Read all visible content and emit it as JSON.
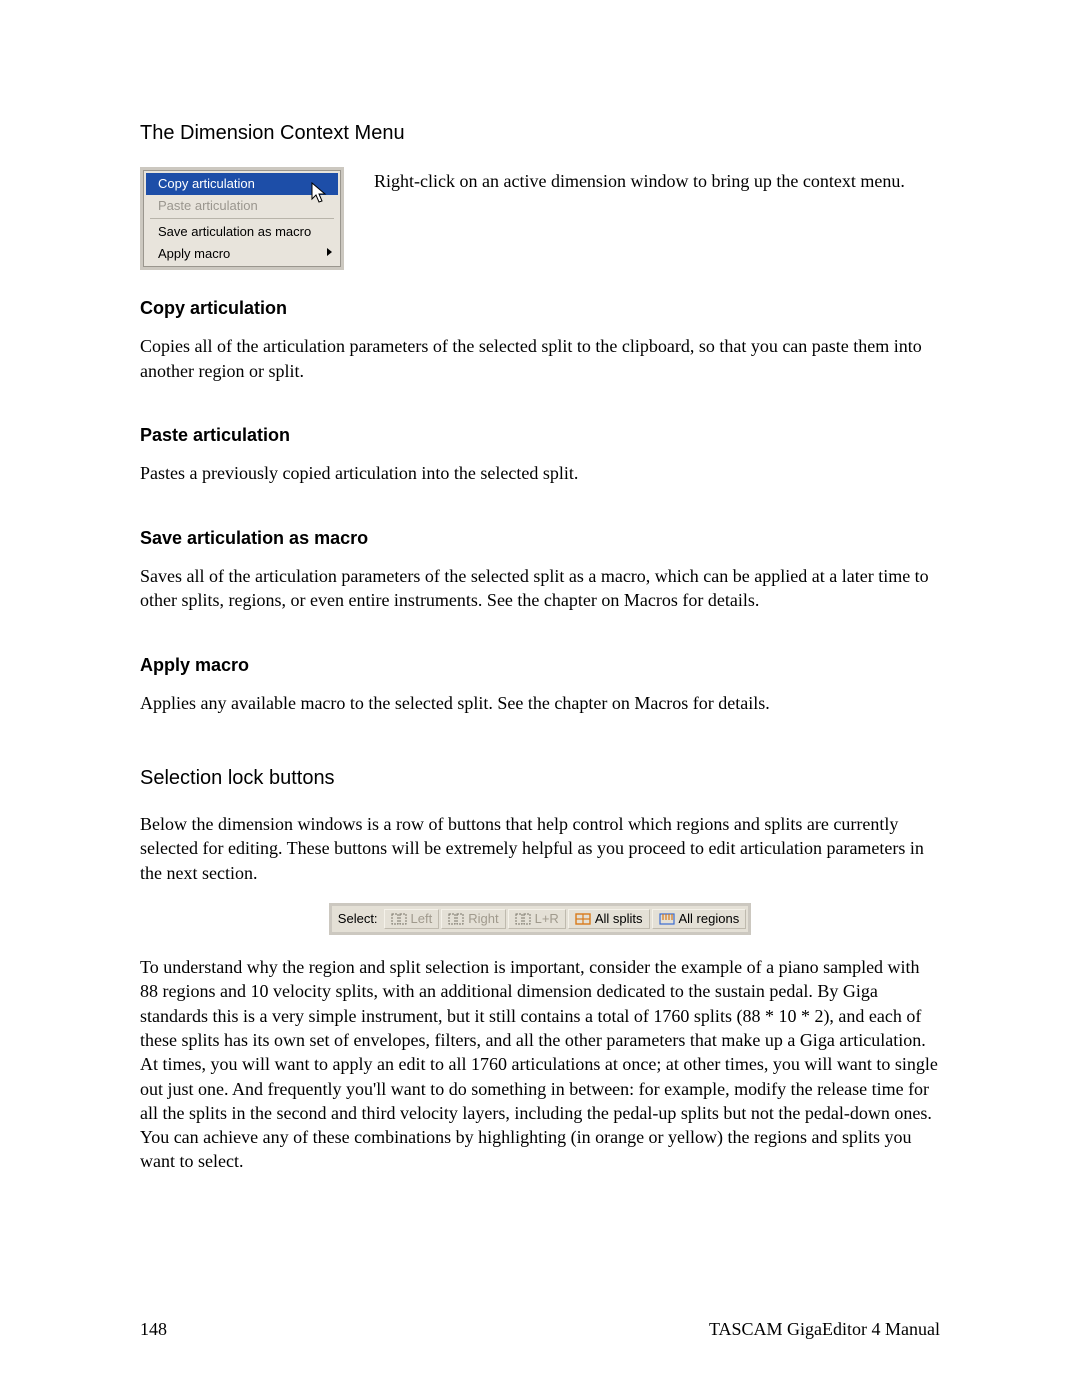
{
  "headings": {
    "dimension_context_menu": "The Dimension Context Menu",
    "copy_articulation": "Copy articulation",
    "paste_articulation": "Paste articulation",
    "save_macro": "Save articulation as macro",
    "apply_macro": "Apply macro",
    "selection_lock": "Selection lock buttons"
  },
  "paragraphs": {
    "ctx_intro": "Right-click on an active dimension window to bring up the context menu.",
    "copy_desc": "Copies all of the articulation parameters of the selected split to the clipboard, so that you can paste them into another region or split.",
    "paste_desc": "Pastes a previously copied articulation into the selected split.",
    "save_macro_desc": "Saves all of the articulation parameters of the selected split as a macro, which can be applied at a later time to other splits, regions, or even entire instruments.  See the chapter on Macros for details.",
    "apply_macro_desc": "Applies any available macro to the selected split.  See the chapter on Macros for details.",
    "lock_intro": "Below the dimension windows is a row of buttons that help control which regions and splits are currently selected for editing.  These buttons will be extremely helpful as you proceed to edit articulation parameters in the next section.",
    "lock_details": "To understand why the region and split selection is important, consider the example of a piano sampled with 88 regions and 10 velocity splits, with an additional dimension dedicated to the sustain pedal.  By Giga standards this is a very simple instrument, but it still contains a total of 1760 splits (88 * 10 * 2), and each of these splits has its own set of envelopes, filters, and all the other parameters that make up a Giga articulation.  At times, you will want to apply an edit to all 1760 articulations at once; at other times, you will want to single out just one.  And frequently you'll want to do something in between: for example, modify the release time for all the splits in the second and third velocity layers, including the pedal-up splits but not the pedal-down ones.  You can achieve any of these combinations by highlighting (in orange or yellow) the regions and splits you want to select."
  },
  "context_menu": {
    "items": [
      "Copy articulation",
      "Paste articulation",
      "Save articulation as macro",
      "Apply macro"
    ]
  },
  "lockbar": {
    "label": "Select:",
    "buttons": {
      "left": "Left",
      "right": "Right",
      "lr": "L+R",
      "all_splits": "All splits",
      "all_regions": "All regions"
    }
  },
  "footer": {
    "page": "148",
    "title": "TASCAM GigaEditor 4 Manual"
  }
}
